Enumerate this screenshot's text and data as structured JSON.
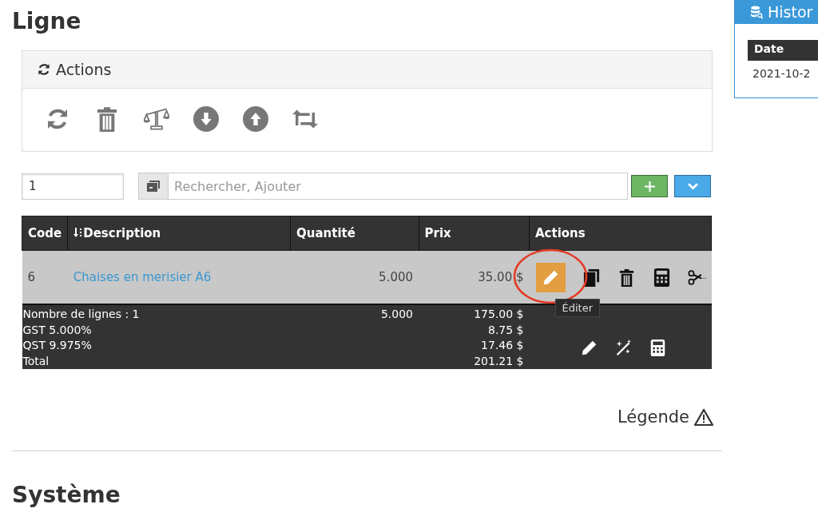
{
  "heading": "Ligne",
  "actions_panel": {
    "title": "Actions",
    "tools": [
      {
        "kind": "refresh"
      },
      {
        "kind": "trash"
      },
      {
        "kind": "scale"
      },
      {
        "kind": "down"
      },
      {
        "kind": "up"
      },
      {
        "kind": "swap"
      }
    ]
  },
  "quantity_field": {
    "value": "1"
  },
  "search": {
    "placeholder": "Rechercher, Ajouter"
  },
  "table": {
    "columns": [
      {
        "label": "Code",
        "sortable": false
      },
      {
        "label": "Description",
        "sortable": true
      },
      {
        "label": "Quantité",
        "sortable": false
      },
      {
        "label": "Prix",
        "sortable": false
      },
      {
        "label": "Actions",
        "sortable": false
      }
    ],
    "rows": [
      {
        "code": "6",
        "description": "Chaises en merisier A6",
        "quantity": "5.000",
        "price": "35.00 $",
        "actions": [
          {
            "kind": "edit",
            "highlighted": true
          },
          {
            "kind": "copy",
            "highlighted": false
          },
          {
            "kind": "trash",
            "highlighted": false
          },
          {
            "kind": "calculator",
            "highlighted": false
          },
          {
            "kind": "scissors",
            "highlighted": false
          }
        ]
      }
    ],
    "footer": {
      "labels": [
        "Nombre de lignes : 1",
        "GST 5.000%",
        "QST 9.975%",
        "Total"
      ],
      "quantity": "5.000",
      "amounts": [
        "175.00 $",
        "8.75 $",
        "17.46 $",
        "201.21 $"
      ],
      "actions": [
        {
          "kind": "edit"
        },
        {
          "kind": "magic"
        },
        {
          "kind": "calculator"
        }
      ]
    }
  },
  "tooltip": "Éditer",
  "legend": "Légende",
  "section_heading": "Système",
  "history_panel": {
    "title": "Histor",
    "column": "Date",
    "cell": "2021-10-2"
  }
}
